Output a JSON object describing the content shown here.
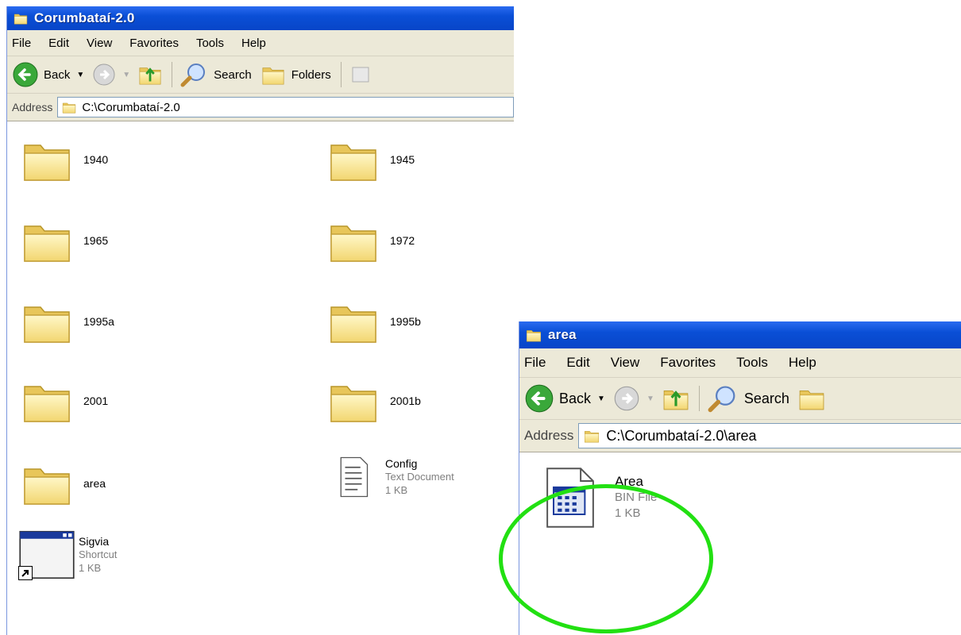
{
  "window_main": {
    "title": "Corumbataí-2.0",
    "menu": [
      "File",
      "Edit",
      "View",
      "Favorites",
      "Tools",
      "Help"
    ],
    "toolbar": {
      "back": "Back",
      "search": "Search",
      "folders": "Folders"
    },
    "address_label": "Address",
    "address_path": "C:\\Corumbataí-2.0",
    "items": [
      {
        "name": "1940",
        "kind": "folder"
      },
      {
        "name": "1945",
        "kind": "folder"
      },
      {
        "name": "1965",
        "kind": "folder"
      },
      {
        "name": "1972",
        "kind": "folder"
      },
      {
        "name": "1995a",
        "kind": "folder"
      },
      {
        "name": "1995b",
        "kind": "folder"
      },
      {
        "name": "2001",
        "kind": "folder"
      },
      {
        "name": "2001b",
        "kind": "folder"
      },
      {
        "name": "area",
        "kind": "folder"
      },
      {
        "name": "Config",
        "type": "Text Document",
        "size": "1 KB",
        "kind": "text-file"
      },
      {
        "name": "Sigvia",
        "type": "Shortcut",
        "size": "1 KB",
        "kind": "shortcut"
      }
    ]
  },
  "window_area": {
    "title": "area",
    "menu": [
      "File",
      "Edit",
      "View",
      "Favorites",
      "Tools",
      "Help"
    ],
    "toolbar": {
      "back": "Back",
      "search": "Search"
    },
    "address_label": "Address",
    "address_path": "C:\\Corumbataí-2.0\\area",
    "items": [
      {
        "name": "Area",
        "type": "BIN File",
        "size": "1 KB",
        "kind": "bin-file"
      }
    ]
  },
  "colors": {
    "titlebar": "#0a4fd6",
    "chrome": "#ece9d8",
    "highlight_ring": "#22e012"
  }
}
